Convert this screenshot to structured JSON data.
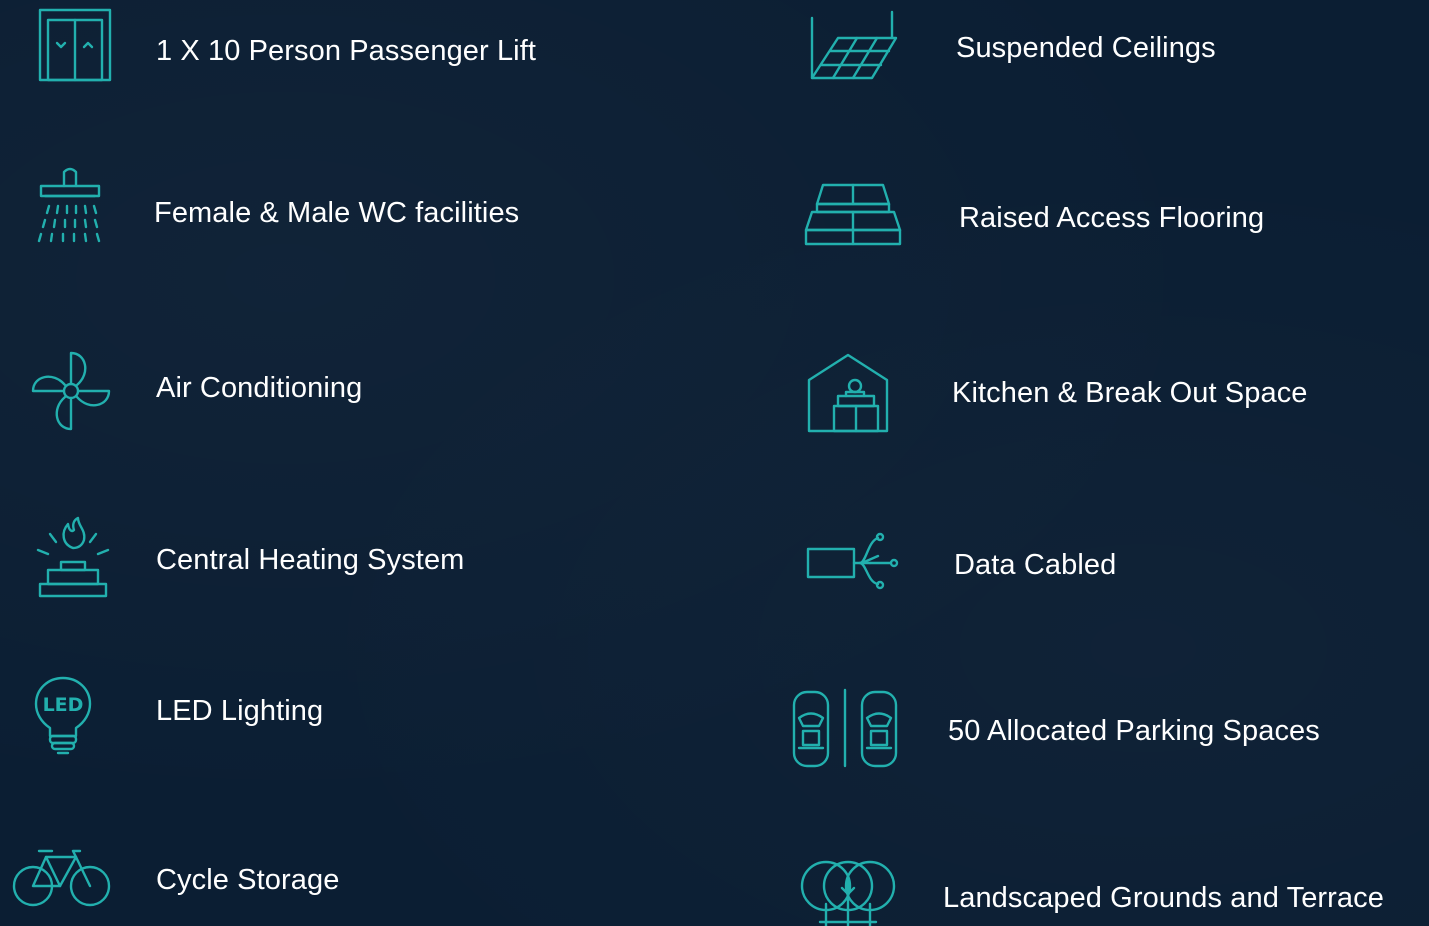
{
  "features": {
    "left": [
      {
        "label": "1 X 10 Person Passenger Lift",
        "icon": "lift-icon"
      },
      {
        "label": "Female & Male WC facilities",
        "icon": "shower-icon"
      },
      {
        "label": "Air Conditioning",
        "icon": "fan-icon"
      },
      {
        "label": "Central Heating System",
        "icon": "heating-icon"
      },
      {
        "label": "LED Lighting",
        "icon": "led-bulb-icon"
      },
      {
        "label": "Cycle Storage",
        "icon": "bicycle-icon"
      }
    ],
    "right": [
      {
        "label": "Suspended Ceilings",
        "icon": "ceiling-grid-icon"
      },
      {
        "label": "Raised Access Flooring",
        "icon": "floor-panels-icon"
      },
      {
        "label": "Kitchen & Break Out Space",
        "icon": "kitchen-house-icon"
      },
      {
        "label": "Data Cabled",
        "icon": "data-cable-icon"
      },
      {
        "label": "50 Allocated Parking Spaces",
        "icon": "parking-cars-icon"
      },
      {
        "label": "Landscaped Grounds and Terrace",
        "icon": "trees-icon"
      }
    ]
  },
  "icon_text": {
    "led": "LED"
  },
  "colors": {
    "background": "#0b1e33",
    "icon": "#22b0ae",
    "text": "#ffffff"
  }
}
